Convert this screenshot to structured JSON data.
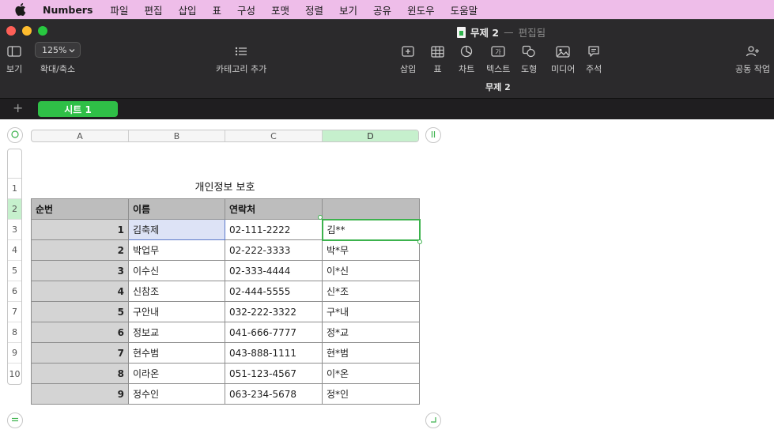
{
  "menubar": {
    "app_name": "Numbers",
    "items": [
      "파일",
      "편집",
      "삽입",
      "표",
      "구성",
      "포맷",
      "정렬",
      "보기",
      "공유",
      "윈도우",
      "도움말"
    ]
  },
  "window": {
    "title": "무제 2",
    "title_separator": "—",
    "title_state": "편집됨",
    "subtitle": "무제 2"
  },
  "toolbar": {
    "view_label": "보기",
    "zoom_value": "125%",
    "zoom_label": "확대/축소",
    "category_label": "카테고리 추가",
    "insert_label": "삽입",
    "table_label": "표",
    "chart_label": "차트",
    "text_label": "텍스트",
    "shape_label": "도형",
    "media_label": "미디어",
    "comment_label": "주석",
    "collab_label": "공동 작업"
  },
  "sheets": {
    "add_symbol": "+",
    "active_tab": "시트 1"
  },
  "spreadsheet": {
    "columns": [
      "A",
      "B",
      "C",
      "D"
    ],
    "active_column": "D",
    "row_numbers": [
      "1",
      "2",
      "3",
      "4",
      "5",
      "6",
      "7",
      "8",
      "9",
      "10"
    ],
    "active_row": "2",
    "table_title": "개인정보 보호",
    "headers": [
      "순번",
      "이름",
      "연락처",
      ""
    ],
    "rows": [
      [
        "1",
        "김축제",
        "02-111-2222",
        "김**"
      ],
      [
        "2",
        "박업무",
        "02-222-3333",
        "박*무"
      ],
      [
        "3",
        "이수신",
        "02-333-4444",
        "이*신"
      ],
      [
        "4",
        "신참조",
        "02-444-5555",
        "신*조"
      ],
      [
        "5",
        "구안내",
        "032-222-3322",
        "구*내"
      ],
      [
        "6",
        "정보교",
        "041-666-7777",
        "정*교"
      ],
      [
        "7",
        "현수범",
        "043-888-1111",
        "현*범"
      ],
      [
        "8",
        "이라온",
        "051-123-4567",
        "이*온"
      ],
      [
        "9",
        "정수인",
        "063-234-5678",
        "정*인"
      ]
    ]
  },
  "colors": {
    "menubar_bg": "#eebde9",
    "titlebar_bg": "#2b2a2c",
    "accent_green": "#2fbf47",
    "selection_blue": "#dde3f6",
    "header_gray": "#bdbdbd"
  }
}
